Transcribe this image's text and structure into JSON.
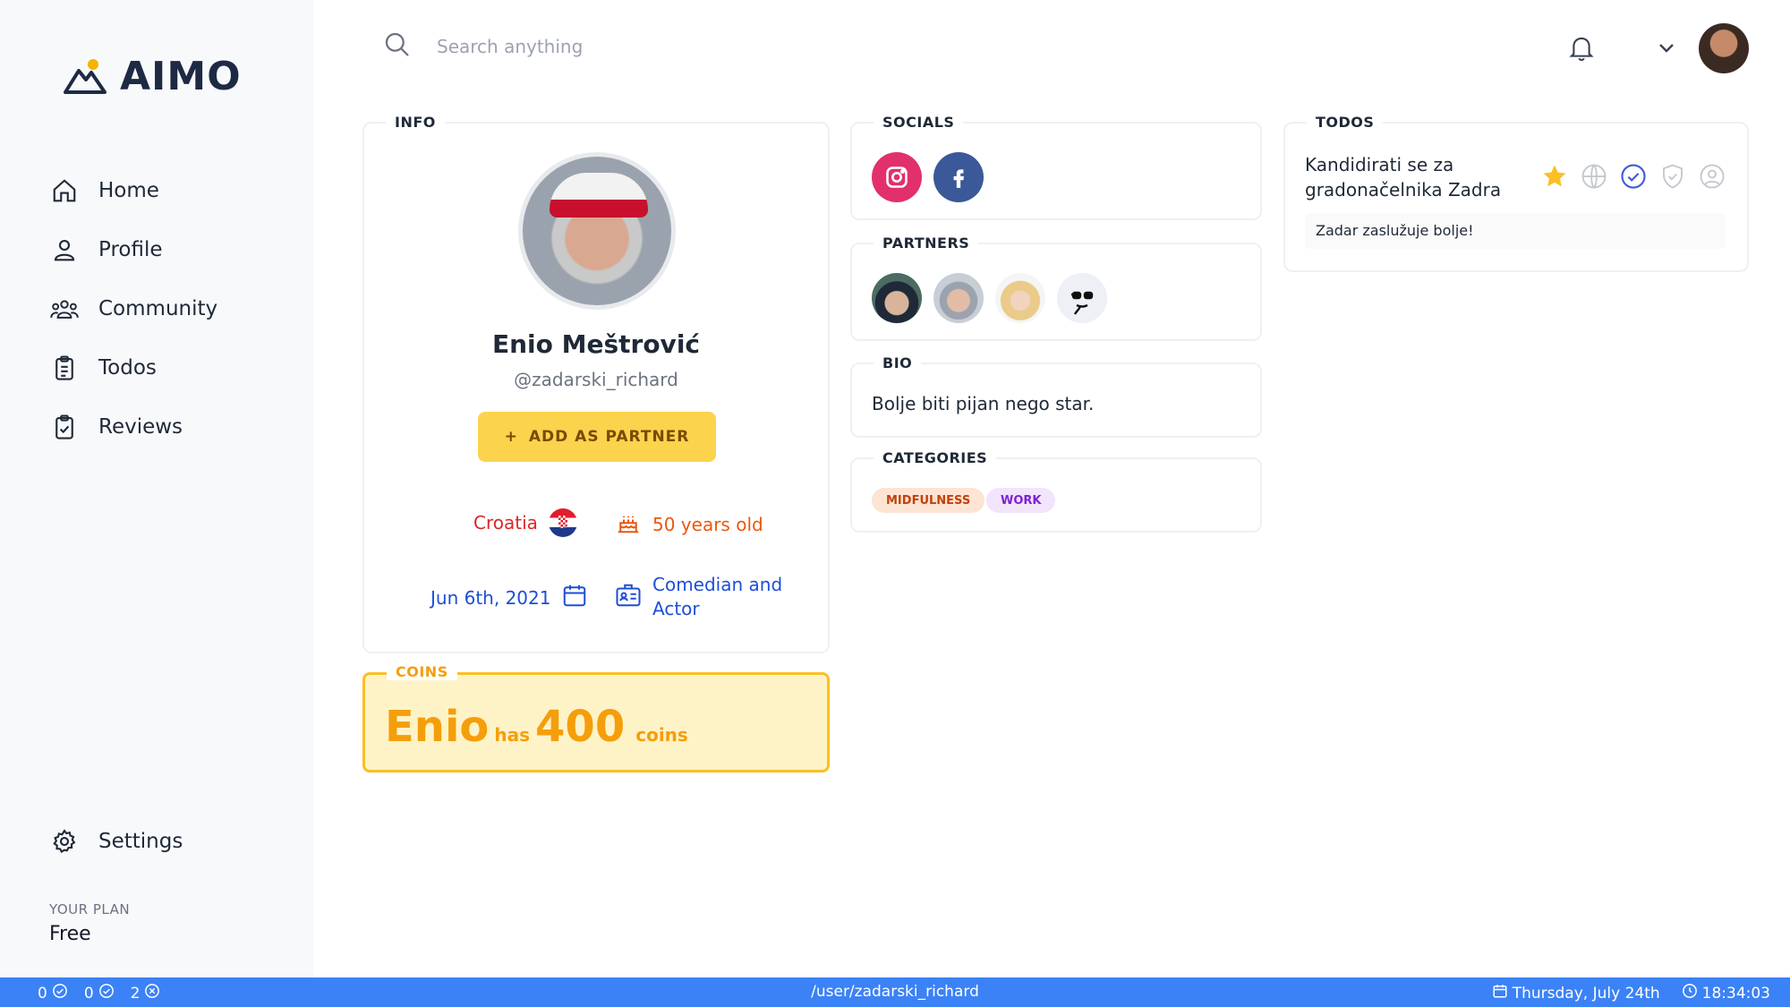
{
  "app": {
    "logo_text": "AIMO"
  },
  "sidebar": {
    "items": [
      {
        "label": "Home",
        "icon": "home-icon"
      },
      {
        "label": "Profile",
        "icon": "user-icon"
      },
      {
        "label": "Community",
        "icon": "users-icon"
      },
      {
        "label": "Todos",
        "icon": "clipboard-list-icon"
      },
      {
        "label": "Reviews",
        "icon": "clipboard-check-icon"
      }
    ],
    "settings_label": "Settings",
    "plan_label": "YOUR PLAN",
    "plan_value": "Free"
  },
  "topbar": {
    "search_placeholder": "Search anything"
  },
  "info": {
    "section_label": "INFO",
    "name": "Enio Meštrović",
    "handle": "@zadarski_richard",
    "partner_button": "ADD AS PARTNER",
    "country": "Croatia",
    "age": "50 years old",
    "joined": "Jun 6th, 2021",
    "occupation_line1": "Comedian and",
    "occupation_line2": "Actor"
  },
  "coins": {
    "section_label": "COINS",
    "first_name": "Enio",
    "has_word": "has",
    "amount": "400",
    "unit": "coins"
  },
  "socials": {
    "section_label": "SOCIALS",
    "items": [
      "instagram",
      "facebook"
    ]
  },
  "partners": {
    "section_label": "PARTNERS",
    "count": 4
  },
  "bio": {
    "section_label": "BIO",
    "text": "Bolje biti pijan nego star."
  },
  "categories": {
    "section_label": "CATEGORIES",
    "tags": [
      "MIDFULNESS",
      "WORK"
    ]
  },
  "todos": {
    "section_label": "TODOS",
    "items": [
      {
        "title_line1": "Kandidirati se za",
        "title_line2": "gradonačelnika Zadra",
        "description": "Zadar zaslužuje bolje!",
        "starred": true
      }
    ]
  },
  "statusbar": {
    "count_a": "0",
    "count_b": "0",
    "count_c": "2",
    "path": "/user/zadarski_richard",
    "date": "Thursday, July 24th",
    "time": "18:34:03"
  },
  "colors": {
    "accent": "#3b82f6",
    "coins": "#f59e0b",
    "button": "#fcd34d"
  }
}
